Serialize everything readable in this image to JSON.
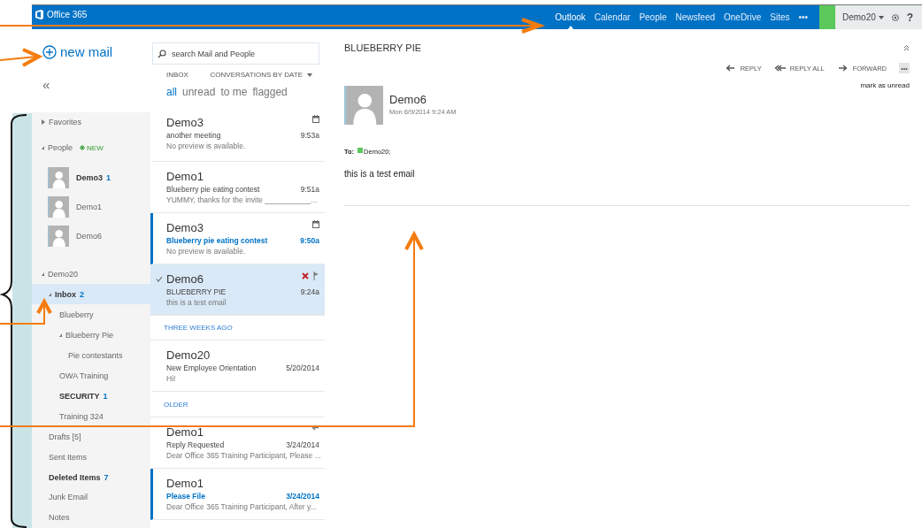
{
  "top_bar": {
    "brand": "Office 365",
    "links": [
      {
        "label": "Outlook",
        "selected": true
      },
      {
        "label": "Calendar",
        "selected": false
      },
      {
        "label": "People",
        "selected": false
      },
      {
        "label": "Newsfeed",
        "selected": false
      },
      {
        "label": "OneDrive",
        "selected": false
      },
      {
        "label": "Sites",
        "selected": false
      }
    ],
    "more": "•••",
    "user": "Demo20",
    "help": "?"
  },
  "sidebar": {
    "new_mail": "new mail",
    "collapse": "«",
    "favorites": {
      "label": "Favorites",
      "expanded": false
    },
    "people": {
      "label": "People",
      "badge": "NEW",
      "expanded": true,
      "contacts": [
        {
          "name": "Demo3",
          "count": "1",
          "unread": true
        },
        {
          "name": "Demo1",
          "unread": false
        },
        {
          "name": "Demo6",
          "unread": false
        }
      ]
    },
    "folders": [
      {
        "label": "Demo20",
        "expanded": true,
        "selected": false,
        "bold": false,
        "children": [
          {
            "label": "Inbox",
            "count": "2",
            "expanded": true,
            "selected": true,
            "bold": true,
            "children": [
              {
                "label": "Blueberry",
                "selected": false,
                "bold": false
              },
              {
                "label": "Blueberry Pie",
                "expanded": true,
                "selected": false,
                "bold": false,
                "children": [
                  {
                    "label": "Pie contestants",
                    "selected": false,
                    "bold": false
                  }
                ]
              },
              {
                "label": "OWA Training",
                "selected": false,
                "bold": false
              },
              {
                "label": "SECURITY",
                "count": "1",
                "selected": false,
                "bold": true
              },
              {
                "label": "Training 324",
                "selected": false,
                "bold": false
              }
            ]
          },
          {
            "label": "Drafts [5]",
            "selected": false,
            "bold": false
          },
          {
            "label": "Sent Items",
            "selected": false,
            "bold": false
          },
          {
            "label": "Deleted Items",
            "count": "7",
            "selected": false,
            "bold": true
          },
          {
            "label": "Junk Email",
            "selected": false,
            "bold": false
          },
          {
            "label": "Notes",
            "selected": false,
            "bold": false
          }
        ]
      }
    ]
  },
  "message_list": {
    "search": {
      "placeholder": "search Mail and People"
    },
    "folder": "INBOX",
    "sort": "CONVERSATIONS BY DATE",
    "filters": [
      {
        "label": "all",
        "selected": true
      },
      {
        "label": "unread",
        "selected": false
      },
      {
        "label": "to me",
        "selected": false
      },
      {
        "label": "flagged",
        "selected": false
      }
    ],
    "items": [
      {
        "kind": "message",
        "sender": "Demo3",
        "subject": "another meeting",
        "time": "9:53a",
        "preview": "No preview is available.",
        "meeting": true,
        "replied": false,
        "unread": false,
        "selected": false
      },
      {
        "kind": "message",
        "sender": "Demo1",
        "subject": "Blueberry pie eating contest",
        "time": "9:51a",
        "preview": "YUMMY, thanks for the invite ___________...",
        "meeting": false,
        "replied": false,
        "unread": false,
        "selected": false
      },
      {
        "kind": "message",
        "sender": "Demo3",
        "subject": "Blueberry pie eating contest",
        "time": "9:50a",
        "preview": "No preview is available.",
        "meeting": true,
        "replied": false,
        "unread": true,
        "selected": false
      },
      {
        "kind": "message",
        "sender": "Demo6",
        "subject": "BLUEBERRY PIE",
        "time": "9:24a",
        "preview": "this is a test email",
        "meeting": false,
        "replied": false,
        "unread": false,
        "selected": true
      },
      {
        "kind": "header",
        "label": "THREE WEEKS AGO"
      },
      {
        "kind": "message",
        "sender": "Demo20",
        "subject": "New Employee Orientation",
        "time": "5/20/2014",
        "preview": "Hi!",
        "meeting": false,
        "replied": false,
        "unread": false,
        "selected": false
      },
      {
        "kind": "header",
        "label": "OLDER"
      },
      {
        "kind": "message",
        "sender": "Demo1",
        "subject": "Reply Requested",
        "time": "3/24/2014",
        "preview": "Dear Office 365 Training Participant,   Please ...",
        "meeting": false,
        "replied": true,
        "unread": false,
        "selected": false
      },
      {
        "kind": "message",
        "sender": "Demo1",
        "subject": "Please File",
        "time": "3/24/2014",
        "preview": "Dear Office 365 Training Participant,   After y...",
        "meeting": false,
        "replied": false,
        "unread": true,
        "selected": false
      }
    ]
  },
  "reading_pane": {
    "title": "BLUEBERRY PIE",
    "actions": [
      {
        "kind": "reply",
        "label": "REPLY"
      },
      {
        "kind": "reply-all",
        "label": "REPLY ALL"
      },
      {
        "kind": "forward",
        "label": "FORWARD"
      }
    ],
    "more": "•••",
    "mark_unread": "mark as unread",
    "sender": "Demo6",
    "date": "Mon 6/9/2014 9:24 AM",
    "to_label": "To:",
    "recipient": {
      "name": "Demo20;",
      "color": "#5ac85a"
    },
    "body": "this is a test email"
  }
}
